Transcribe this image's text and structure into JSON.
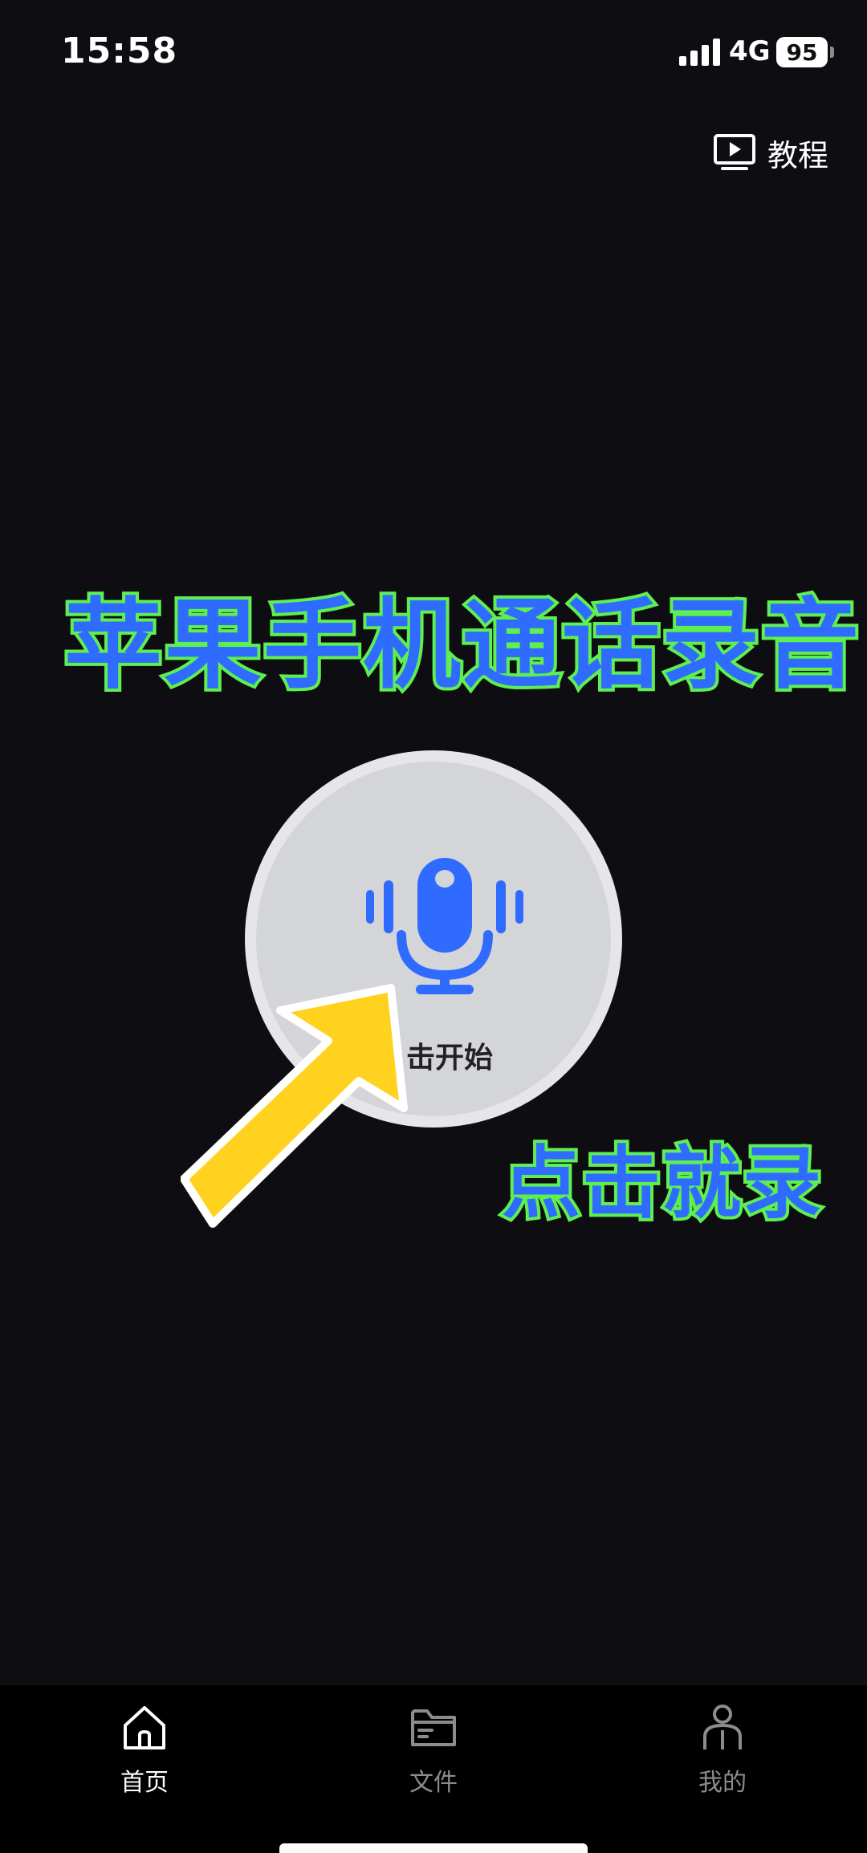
{
  "status_bar": {
    "time": "15:58",
    "network": "4G",
    "battery_level": "95"
  },
  "header": {
    "tutorial_label": "教程"
  },
  "overlay": {
    "title_caption": "苹果手机通话录音",
    "hint_caption": "点击就录"
  },
  "record": {
    "label": "击开始"
  },
  "tab_bar": {
    "tabs": [
      {
        "label": "首页",
        "active": true
      },
      {
        "label": "文件",
        "active": false
      },
      {
        "label": "我的",
        "active": false
      }
    ]
  },
  "colors": {
    "background": "#0d0d12",
    "mic_blue": "#2f6bff",
    "caption_outline": "#5ef04f",
    "arrow_yellow": "#ffd21f"
  }
}
